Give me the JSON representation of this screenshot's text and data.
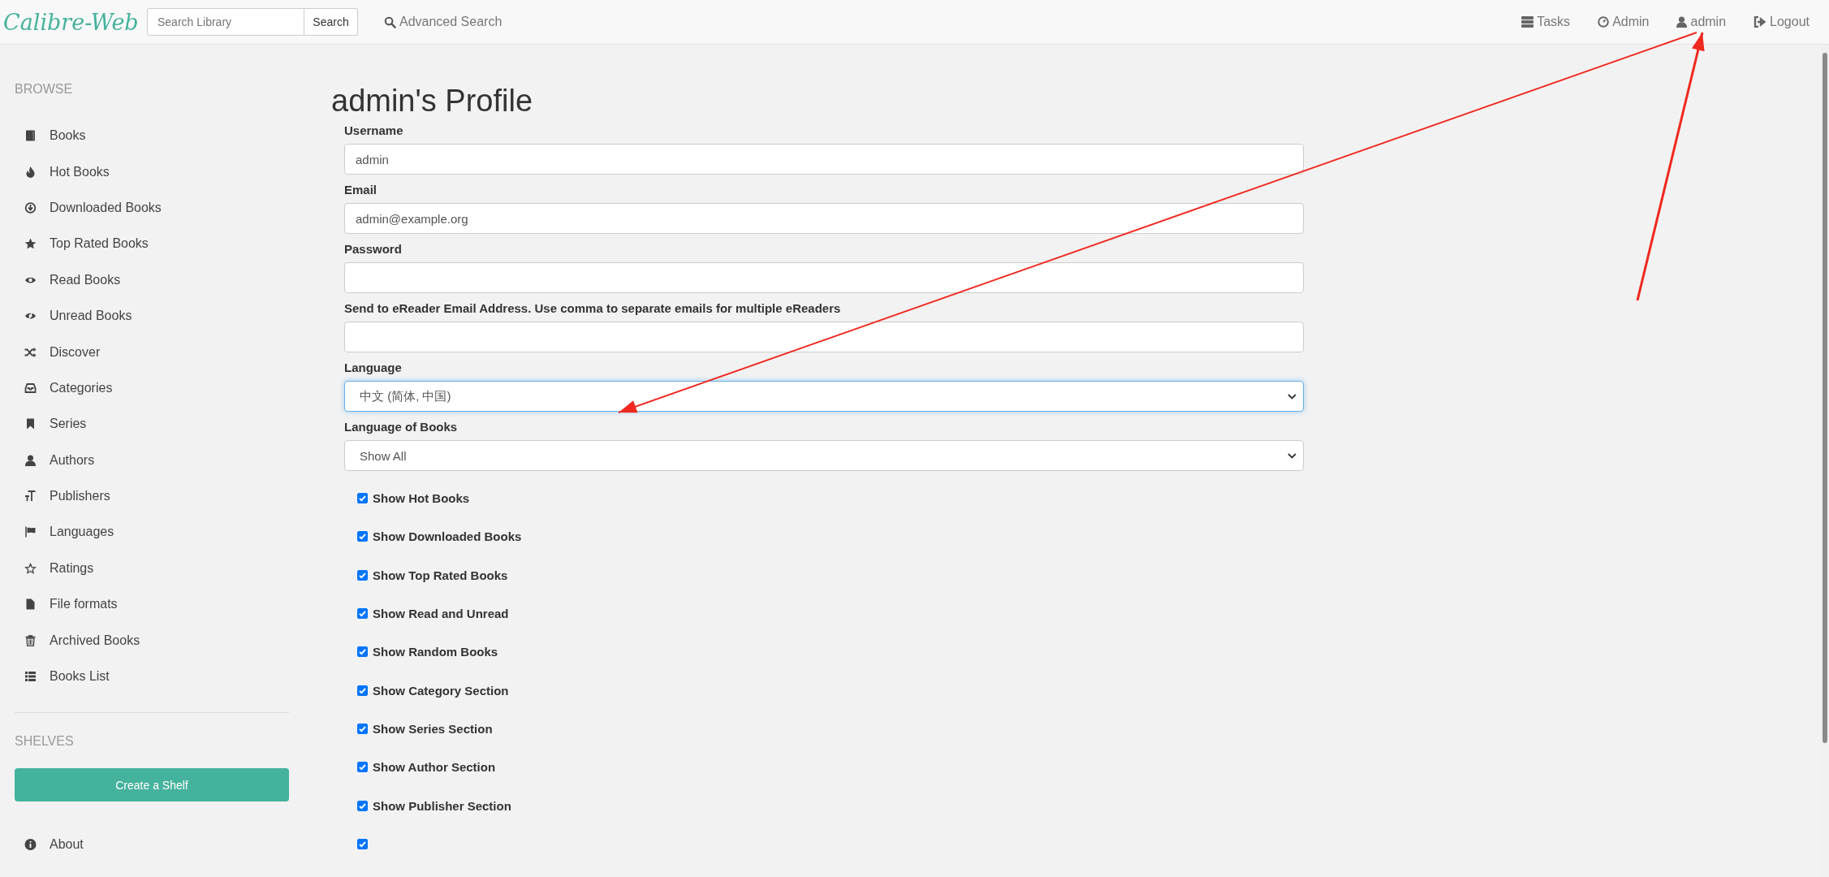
{
  "navbar": {
    "logo": "Calibre-Web",
    "search": {
      "placeholder": "Search Library",
      "button": "Search"
    },
    "advanced_search": "Advanced Search",
    "links": [
      {
        "kind": "tasks",
        "label": "Tasks"
      },
      {
        "kind": "admin",
        "label": "Admin"
      },
      {
        "kind": "user",
        "label": "admin"
      },
      {
        "kind": "logout",
        "label": "Logout"
      }
    ]
  },
  "sidebar": {
    "browse_heading": "BROWSE",
    "items": [
      {
        "kind": "book",
        "label": "Books"
      },
      {
        "kind": "fire",
        "label": "Hot Books"
      },
      {
        "kind": "download",
        "label": "Downloaded Books"
      },
      {
        "kind": "star",
        "label": "Top Rated Books"
      },
      {
        "kind": "eye",
        "label": "Read Books"
      },
      {
        "kind": "eye-slash",
        "label": "Unread Books"
      },
      {
        "kind": "shuffle",
        "label": "Discover"
      },
      {
        "kind": "inbox",
        "label": "Categories"
      },
      {
        "kind": "bookmark",
        "label": "Series"
      },
      {
        "kind": "user",
        "label": "Authors"
      },
      {
        "kind": "text",
        "label": "Publishers"
      },
      {
        "kind": "flag",
        "label": "Languages"
      },
      {
        "kind": "star-empty",
        "label": "Ratings"
      },
      {
        "kind": "file",
        "label": "File formats"
      },
      {
        "kind": "trash",
        "label": "Archived Books"
      },
      {
        "kind": "list",
        "label": "Books List"
      }
    ],
    "shelves_heading": "SHELVES",
    "create_shelf": "Create a Shelf",
    "about": "About"
  },
  "profile": {
    "title": "admin's Profile",
    "fields": [
      {
        "kind": "input",
        "label": "Username",
        "value": "admin"
      },
      {
        "kind": "input",
        "label": "Email",
        "value": "admin@example.org"
      },
      {
        "kind": "input",
        "label": "Password"
      },
      {
        "kind": "input",
        "label": "Send to eReader Email Address. Use comma to separate emails for multiple eReaders"
      },
      {
        "kind": "select",
        "label": "Language",
        "value": "中文 (简体, 中国)",
        "focused": true
      },
      {
        "kind": "select",
        "label": "Language of Books",
        "value": "Show All",
        "focused": false
      }
    ],
    "checkboxes": [
      {
        "label": "Show Hot Books",
        "checked": true
      },
      {
        "label": "Show Downloaded Books",
        "checked": true
      },
      {
        "label": "Show Top Rated Books",
        "checked": true
      },
      {
        "label": "Show Read and Unread",
        "checked": true
      },
      {
        "label": "Show Random Books",
        "checked": true
      },
      {
        "label": "Show Category Section",
        "checked": true
      },
      {
        "label": "Show Series Section",
        "checked": true
      },
      {
        "label": "Show Author Section",
        "checked": true
      },
      {
        "label": "Show Publisher Section",
        "checked": true
      },
      {
        "checked": true
      }
    ]
  },
  "annotations": [
    {
      "kind": "arrow"
    },
    {
      "kind": "arrow"
    }
  ]
}
